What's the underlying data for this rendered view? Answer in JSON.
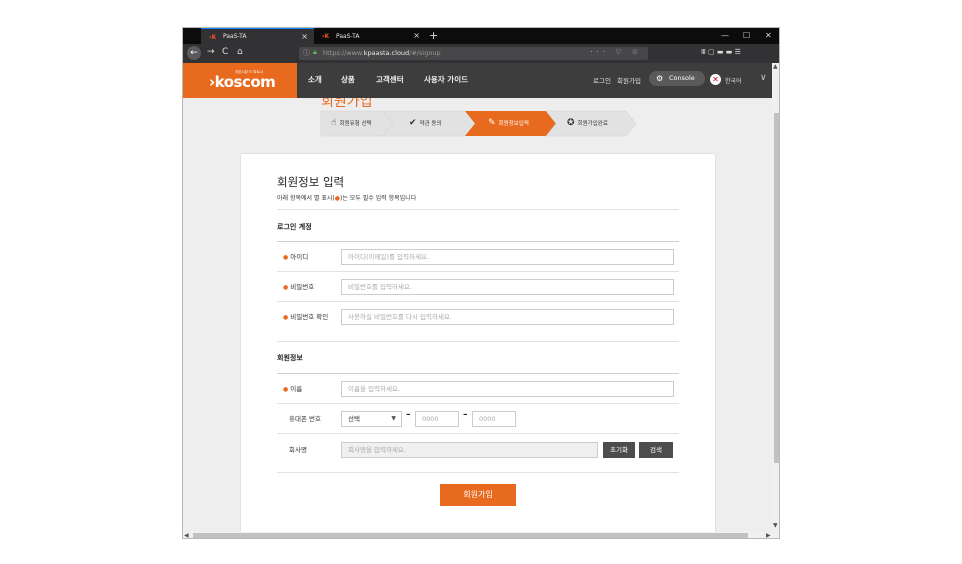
{
  "browser": {
    "tabs": [
      {
        "title": "PaaS-TA",
        "active": true
      },
      {
        "title": "PaaS-TA",
        "active": false
      }
    ],
    "url_prefix": "https://www.",
    "url_domain": "kpaasta.cloud",
    "url_path": "/#/signup",
    "new_tab": "+",
    "close_glyph": "×",
    "minimize": "—",
    "maximize": "☐",
    "close_window": "✕",
    "back": "←",
    "forward": "→",
    "reload": "C",
    "home": "⌂",
    "url_icons": "··· ♡ ☆",
    "right_icons": "Ⅲ ▢ ▬ ▬ ☰"
  },
  "header": {
    "logo_small": "자본시장 IT 파트너",
    "logo_text": "›koscom",
    "menu": [
      "소개",
      "상품",
      "고객센터",
      "사용자 가이드"
    ],
    "login": "로그인",
    "signup": "회원가입",
    "console": "Console",
    "language": "한국어"
  },
  "page": {
    "partial_title": "회원가입",
    "steps": [
      {
        "label": "회원유형 선택",
        "icon": "☝",
        "active": false
      },
      {
        "label": "약관 동의",
        "icon": "✔",
        "active": false
      },
      {
        "label": "회원정보입력",
        "icon": "✎",
        "active": true
      },
      {
        "label": "회원가입완료",
        "icon": "✪",
        "active": false
      }
    ],
    "form": {
      "title": "회원정보 입력",
      "subtitle_before": "아래 항목에서 별 표시(",
      "subtitle_star": "●",
      "subtitle_after": ")는 모두 필수 입력 항목입니다",
      "login_section": "로그인 계정",
      "fields": [
        {
          "label": "아이디",
          "placeholder": "아이디(이메일)를 입력하세요.",
          "required": true
        },
        {
          "label": "비밀번호",
          "placeholder": "비밀번호를 입력하세요.",
          "required": true
        },
        {
          "label": "비밀번호 확인",
          "placeholder": "사용하실 비밀번호를 다시 입력하세요.",
          "required": true
        }
      ],
      "member_section": "회원정보",
      "name_label": "이름",
      "name_placeholder": "이름을 입력하세요.",
      "phone_label": "휴대폰 번호",
      "phone_select": "선택",
      "phone_mid_placeholder": "0000",
      "phone_last_placeholder": "0000",
      "phone_dash": "–",
      "company_label": "회사명",
      "company_placeholder": "회사명을 입력하세요.",
      "reset_button": "초기화",
      "search_button": "검색",
      "submit_button": "회원가입",
      "required_dot": "●"
    }
  },
  "colors": {
    "accent": "#e86a1f",
    "header_bg": "#3d3d3d",
    "step_bg": "#e2e2e2",
    "step_active": "#e86a1f"
  }
}
